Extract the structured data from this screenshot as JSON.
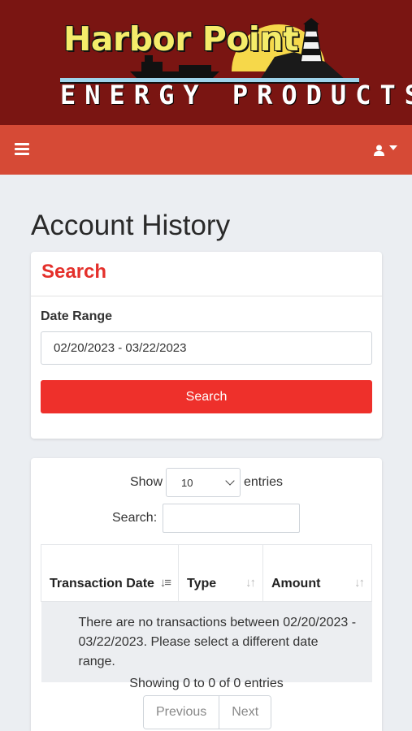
{
  "brand": {
    "title": "Harbor Point",
    "subtitle": "ENERGY PRODUCTS"
  },
  "nav": {
    "menu_icon": "hamburger-icon",
    "user_icon": "user-icon"
  },
  "page": {
    "title": "Account History"
  },
  "search_card": {
    "heading": "Search",
    "date_range_label": "Date Range",
    "date_range_value": "02/20/2023 - 03/22/2023",
    "button_label": "Search"
  },
  "table": {
    "show_label": "Show",
    "entries_value": "10",
    "entries_label": "entries",
    "search_label": "Search:",
    "search_value": "",
    "columns": [
      "Transaction Date",
      "Type",
      "Amount"
    ],
    "empty_message": "There are no transactions between 02/20/2023 - 03/22/2023. Please select a different date range.",
    "info": "Showing 0 to 0 of 0 entries",
    "previous_label": "Previous",
    "next_label": "Next"
  },
  "colors": {
    "brand_bg": "#7a1512",
    "topbar_bg": "#d64a36",
    "accent_red": "#ee302b"
  }
}
